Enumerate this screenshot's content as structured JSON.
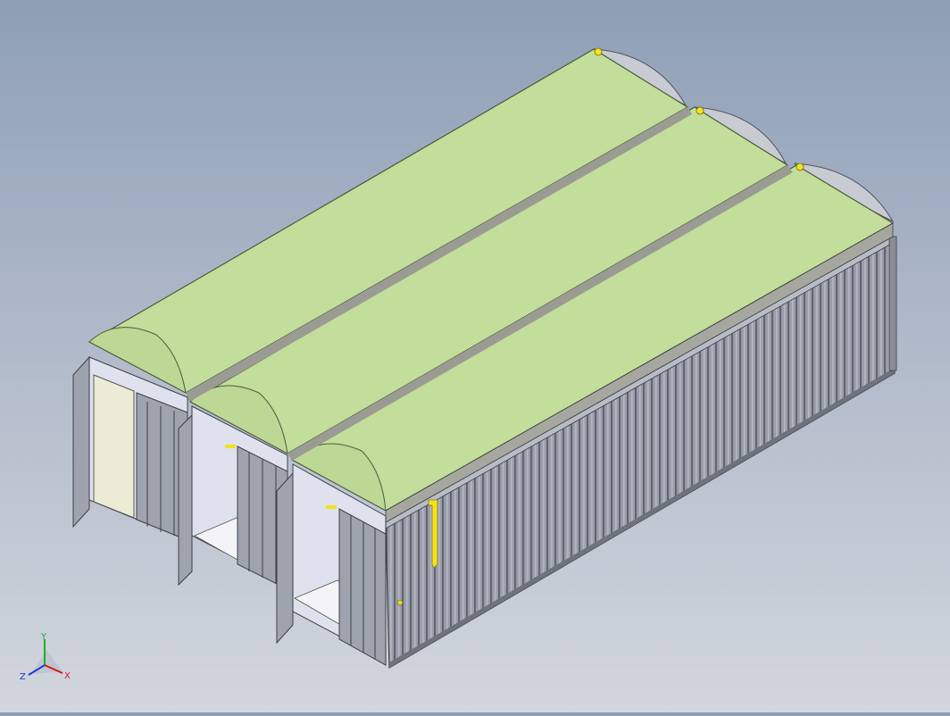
{
  "viewport": {
    "background_top": "#8e9fb6",
    "background_bottom": "#d2d6de"
  },
  "model": {
    "roof_color": "#c3dd9a",
    "roof_edge_color": "#8aa86a",
    "container_wall_color": "#8f939f",
    "container_rib_color": "#5c606c",
    "door_color": "#9ea3ae",
    "interior_color": "#dfe1ee",
    "panel_color": "#ecebd6",
    "fitting_color": "#f3e21f"
  },
  "triad": {
    "x_label": "X",
    "y_label": "Y",
    "z_label": "Z",
    "x_color": "#d21a1a",
    "y_color": "#1fae2c",
    "z_color": "#1f3fd0"
  }
}
